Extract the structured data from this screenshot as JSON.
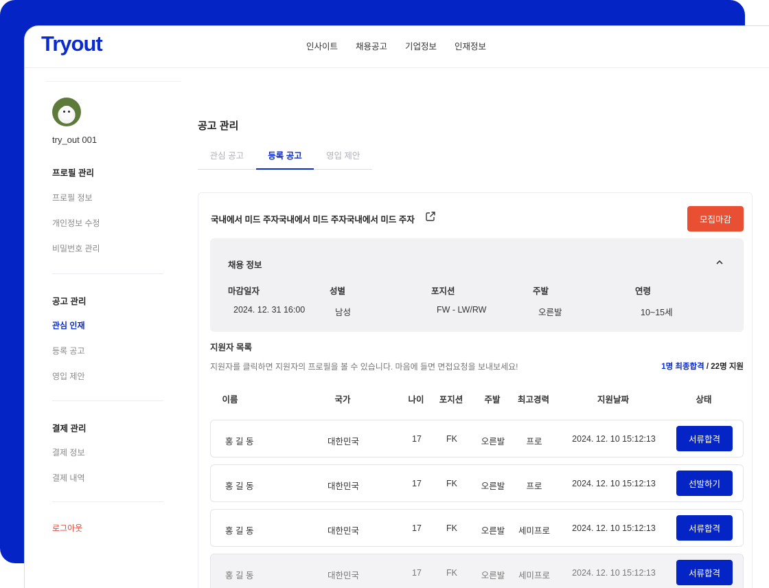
{
  "brand": {
    "logo": "Tryout",
    "accent": "#0a2bd1",
    "bg_blue": "#0424c6",
    "danger": "#e84f33"
  },
  "nav": {
    "items": [
      "인사이트",
      "채용공고",
      "기업정보",
      "인재정보"
    ]
  },
  "sidebar": {
    "username": "try_out 001",
    "sections": [
      {
        "title": "프로필 관리",
        "items": [
          "프로필 정보",
          "개인정보 수정",
          "비밀번호 관리"
        ]
      },
      {
        "title": "공고 관리",
        "items": [
          "관심 인재",
          "등록 공고",
          "영입 제안"
        ]
      },
      {
        "title": "결제 관리",
        "items": [
          "결제 정보",
          "결제 내역"
        ]
      }
    ],
    "active_item": "관심 인재",
    "logout": "로그아웃"
  },
  "main": {
    "page_title": "공고 관리",
    "tabs": [
      "관심 공고",
      "등록 공고",
      "영입 제안"
    ],
    "active_tab": "등록 공고",
    "job": {
      "title": "국내에서 미드 주자국내에서 미드 주자국내에서 미드 주자",
      "close_button": "모집마감",
      "info_title": "채용 정보",
      "info": [
        {
          "label": "마감일자",
          "value": "2024. 12. 31 16:00"
        },
        {
          "label": "성별",
          "value": "남성"
        },
        {
          "label": "포지션",
          "value": "FW - LW/RW"
        },
        {
          "label": "주발",
          "value": "오른발"
        },
        {
          "label": "연령",
          "value": "10~15세"
        }
      ]
    },
    "applicants": {
      "title": "지원자 목록",
      "description": "지원자를 클릭하면 지원자의 프로필을 볼 수 있습니다. 마음에 들면 면접요청을 보내보세요!",
      "count_highlight": "1명 최종합격",
      "count_rest": " / 22명 지원",
      "columns": [
        "이름",
        "국가",
        "나이",
        "포지션",
        "주발",
        "최고경력",
        "지원날짜",
        "상태"
      ],
      "rows": [
        {
          "name": "홍 길 동",
          "country": "대한민국",
          "age": "17",
          "position": "FK",
          "foot": "오른발",
          "career": "프로",
          "date": "2024. 12. 10 15:12:13",
          "status": "서류합격"
        },
        {
          "name": "홍 길 동",
          "country": "대한민국",
          "age": "17",
          "position": "FK",
          "foot": "오른발",
          "career": "프로",
          "date": "2024. 12. 10 15:12:13",
          "status": "선발하기"
        },
        {
          "name": "홍 길 동",
          "country": "대한민국",
          "age": "17",
          "position": "FK",
          "foot": "오른발",
          "career": "세미프로",
          "date": "2024. 12. 10 15:12:13",
          "status": "서류합격"
        },
        {
          "name": "홍 길 동",
          "country": "대한민국",
          "age": "17",
          "position": "FK",
          "foot": "오른발",
          "career": "세미프로",
          "date": "2024. 12. 10 15:12:13",
          "status": "서류합격"
        }
      ]
    }
  }
}
